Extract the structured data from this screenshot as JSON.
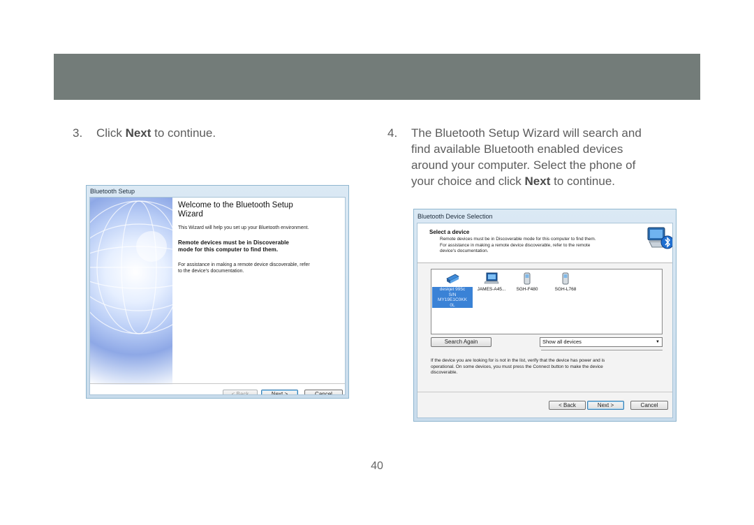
{
  "steps": [
    {
      "number": "3.",
      "pre": "Click ",
      "bold": "Next",
      "post": " to continue."
    },
    {
      "number": "4.",
      "line1": "The Bluetooth Setup Wizard will search and",
      "line2": "find available Bluetooth enabled devices",
      "line3": "around your computer.  Select the phone of",
      "line4_pre": "your choice and click ",
      "line4_bold": "Next",
      "line4_post": " to continue."
    }
  ],
  "welcome_window": {
    "title": "Bluetooth Setup",
    "heading_line1": "Welcome to the Bluetooth Setup",
    "heading_line2": "Wizard",
    "intro": "This Wizard will help you set up your Bluetooth environment.",
    "bold_line1": "Remote devices must be in Discoverable",
    "bold_line2": "mode for this computer to find them.",
    "assist_line1": "For assistance in making a remote device discoverable, refer",
    "assist_line2": "to the device's documentation.",
    "buttons": {
      "back": "< Back",
      "next": "Next >",
      "cancel": "Cancel"
    }
  },
  "selection_window": {
    "title": "Bluetooth Device Selection",
    "heading": "Select a device",
    "desc_line1": "Remote devices must be in Discoverable mode for this computer to find them.",
    "desc_line2": "For assistance in making a remote device discoverable, refer to the remote",
    "desc_line3": "device's documentation.",
    "devices": [
      {
        "label_lines": [
          "deskjet 995c",
          "S/N",
          "MY19E1C0KK",
          "0L"
        ],
        "icon": "printer-icon",
        "selected": true
      },
      {
        "label_lines": [
          "JAMES-A45..."
        ],
        "icon": "computer-icon",
        "selected": false
      },
      {
        "label_lines": [
          "SGH-F480"
        ],
        "icon": "phone-icon",
        "selected": false
      },
      {
        "label_lines": [
          "SGH-L768"
        ],
        "icon": "phone-icon",
        "selected": false
      }
    ],
    "search_again": "Search Again",
    "filter_value": "Show all devices",
    "note_line1": "If the device you are looking for is not in the list, verify that the device has power and is",
    "note_line2": "operational. On some devices, you must press the Connect button to make the device",
    "note_line3": "discoverable.",
    "buttons": {
      "back": "< Back",
      "next": "Next >",
      "cancel": "Cancel"
    }
  },
  "page_number": "40",
  "colors": {
    "header_bar": "#737c79",
    "selection": "#3a82d6",
    "bluetooth": "#1f6fd1"
  }
}
